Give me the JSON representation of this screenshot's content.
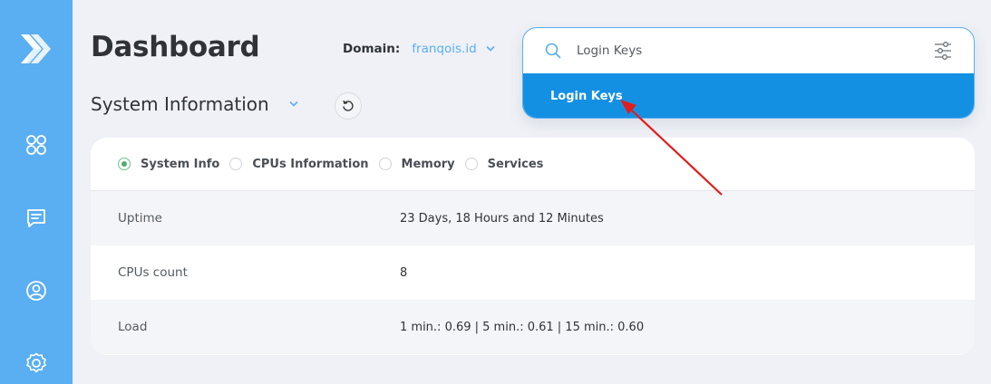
{
  "header": {
    "title": "Dashboard",
    "domain_label": "Domain:",
    "domain_value": "franqois.id"
  },
  "section": {
    "title": "System Information"
  },
  "search": {
    "value": "Login Keys",
    "suggestion": "Login Keys"
  },
  "tabs": [
    {
      "label": "System Info",
      "checked": true
    },
    {
      "label": "CPUs Information",
      "checked": false
    },
    {
      "label": "Memory",
      "checked": false
    },
    {
      "label": "Services",
      "checked": false
    }
  ],
  "rows": [
    {
      "key": "Uptime",
      "value": "23 Days, 18 Hours and 12 Minutes"
    },
    {
      "key": "CPUs count",
      "value": "8"
    },
    {
      "key": "Load",
      "value": "1 min.: 0.69 | 5 min.: 0.61 | 15 min.: 0.60"
    }
  ],
  "sidebar": {
    "icons": [
      "apps-grid-icon",
      "message-icon",
      "user-circle-icon",
      "settings-icon"
    ]
  },
  "colors": {
    "sidebar": "#5aaef2",
    "accent": "#1490e3",
    "radio_checked": "#4cae6e",
    "annotation_arrow": "#e11d1d"
  }
}
